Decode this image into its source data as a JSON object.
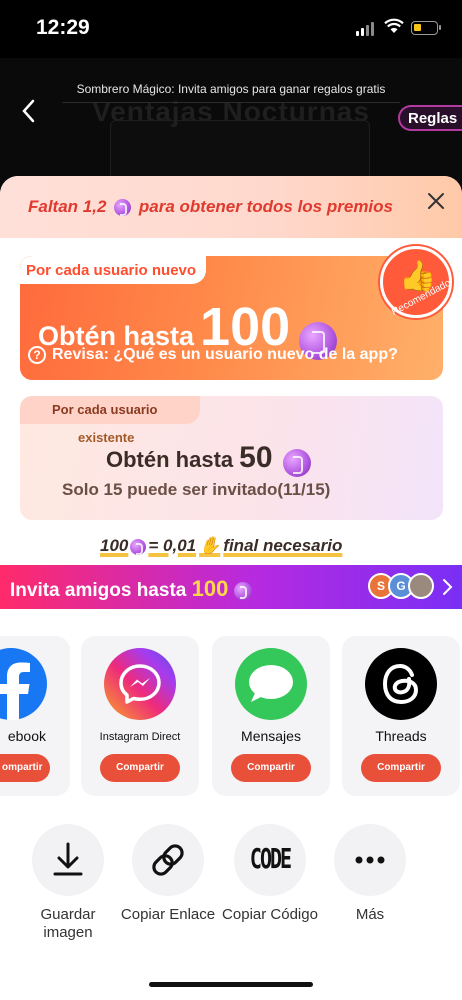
{
  "status_bar": {
    "time": "12:29"
  },
  "header": {
    "caption": "Sombrero Mágico: Invita amigos para ganar regalos gratis",
    "bg_title": "Ventajas Nocturnas",
    "rules_label": "Reglas"
  },
  "banner": {
    "prefix": "Faltan 1,2",
    "suffix": "para obtener todos los premios"
  },
  "card_new": {
    "tag": "Por cada usuario nuevo",
    "get_label": "Obtén hasta",
    "amount": "100",
    "question": "Revisa: ¿Qué es un usuario nuevo de la app?",
    "badge": "Recomendado"
  },
  "card_existing": {
    "tag": "Por cada usuario",
    "tag2": "existente",
    "get_label": "Obtén hasta",
    "amount": "50",
    "limit": "Solo 15 puede ser invitado(11/15)"
  },
  "exchange": {
    "left": "100",
    "right": "= 0,01",
    "suffix": "final necesario"
  },
  "invite_bar": {
    "label": "Invita amigos hasta",
    "amount": "100",
    "avatars": [
      "S",
      "G",
      ""
    ]
  },
  "apps": [
    {
      "label": "ebook",
      "button": "ompartir"
    },
    {
      "label": "Instagram Direct",
      "button": "Compartir"
    },
    {
      "label": "Mensajes",
      "button": "Compartir"
    },
    {
      "label": "Threads",
      "button": "Compartir"
    }
  ],
  "actions": [
    {
      "label": "Guardar imagen",
      "icon": "download-icon"
    },
    {
      "label": "Copiar Enlace",
      "icon": "link-icon"
    },
    {
      "label": "Copiar Código",
      "icon": "code-icon",
      "glyph": "CODE"
    },
    {
      "label": "Más",
      "icon": "more-icon"
    }
  ],
  "colors": {
    "accent": "#e8503a",
    "coin": "#b055e0",
    "invite_gradient_start": "#ff2a6a",
    "invite_gradient_end": "#7a2ff5"
  }
}
